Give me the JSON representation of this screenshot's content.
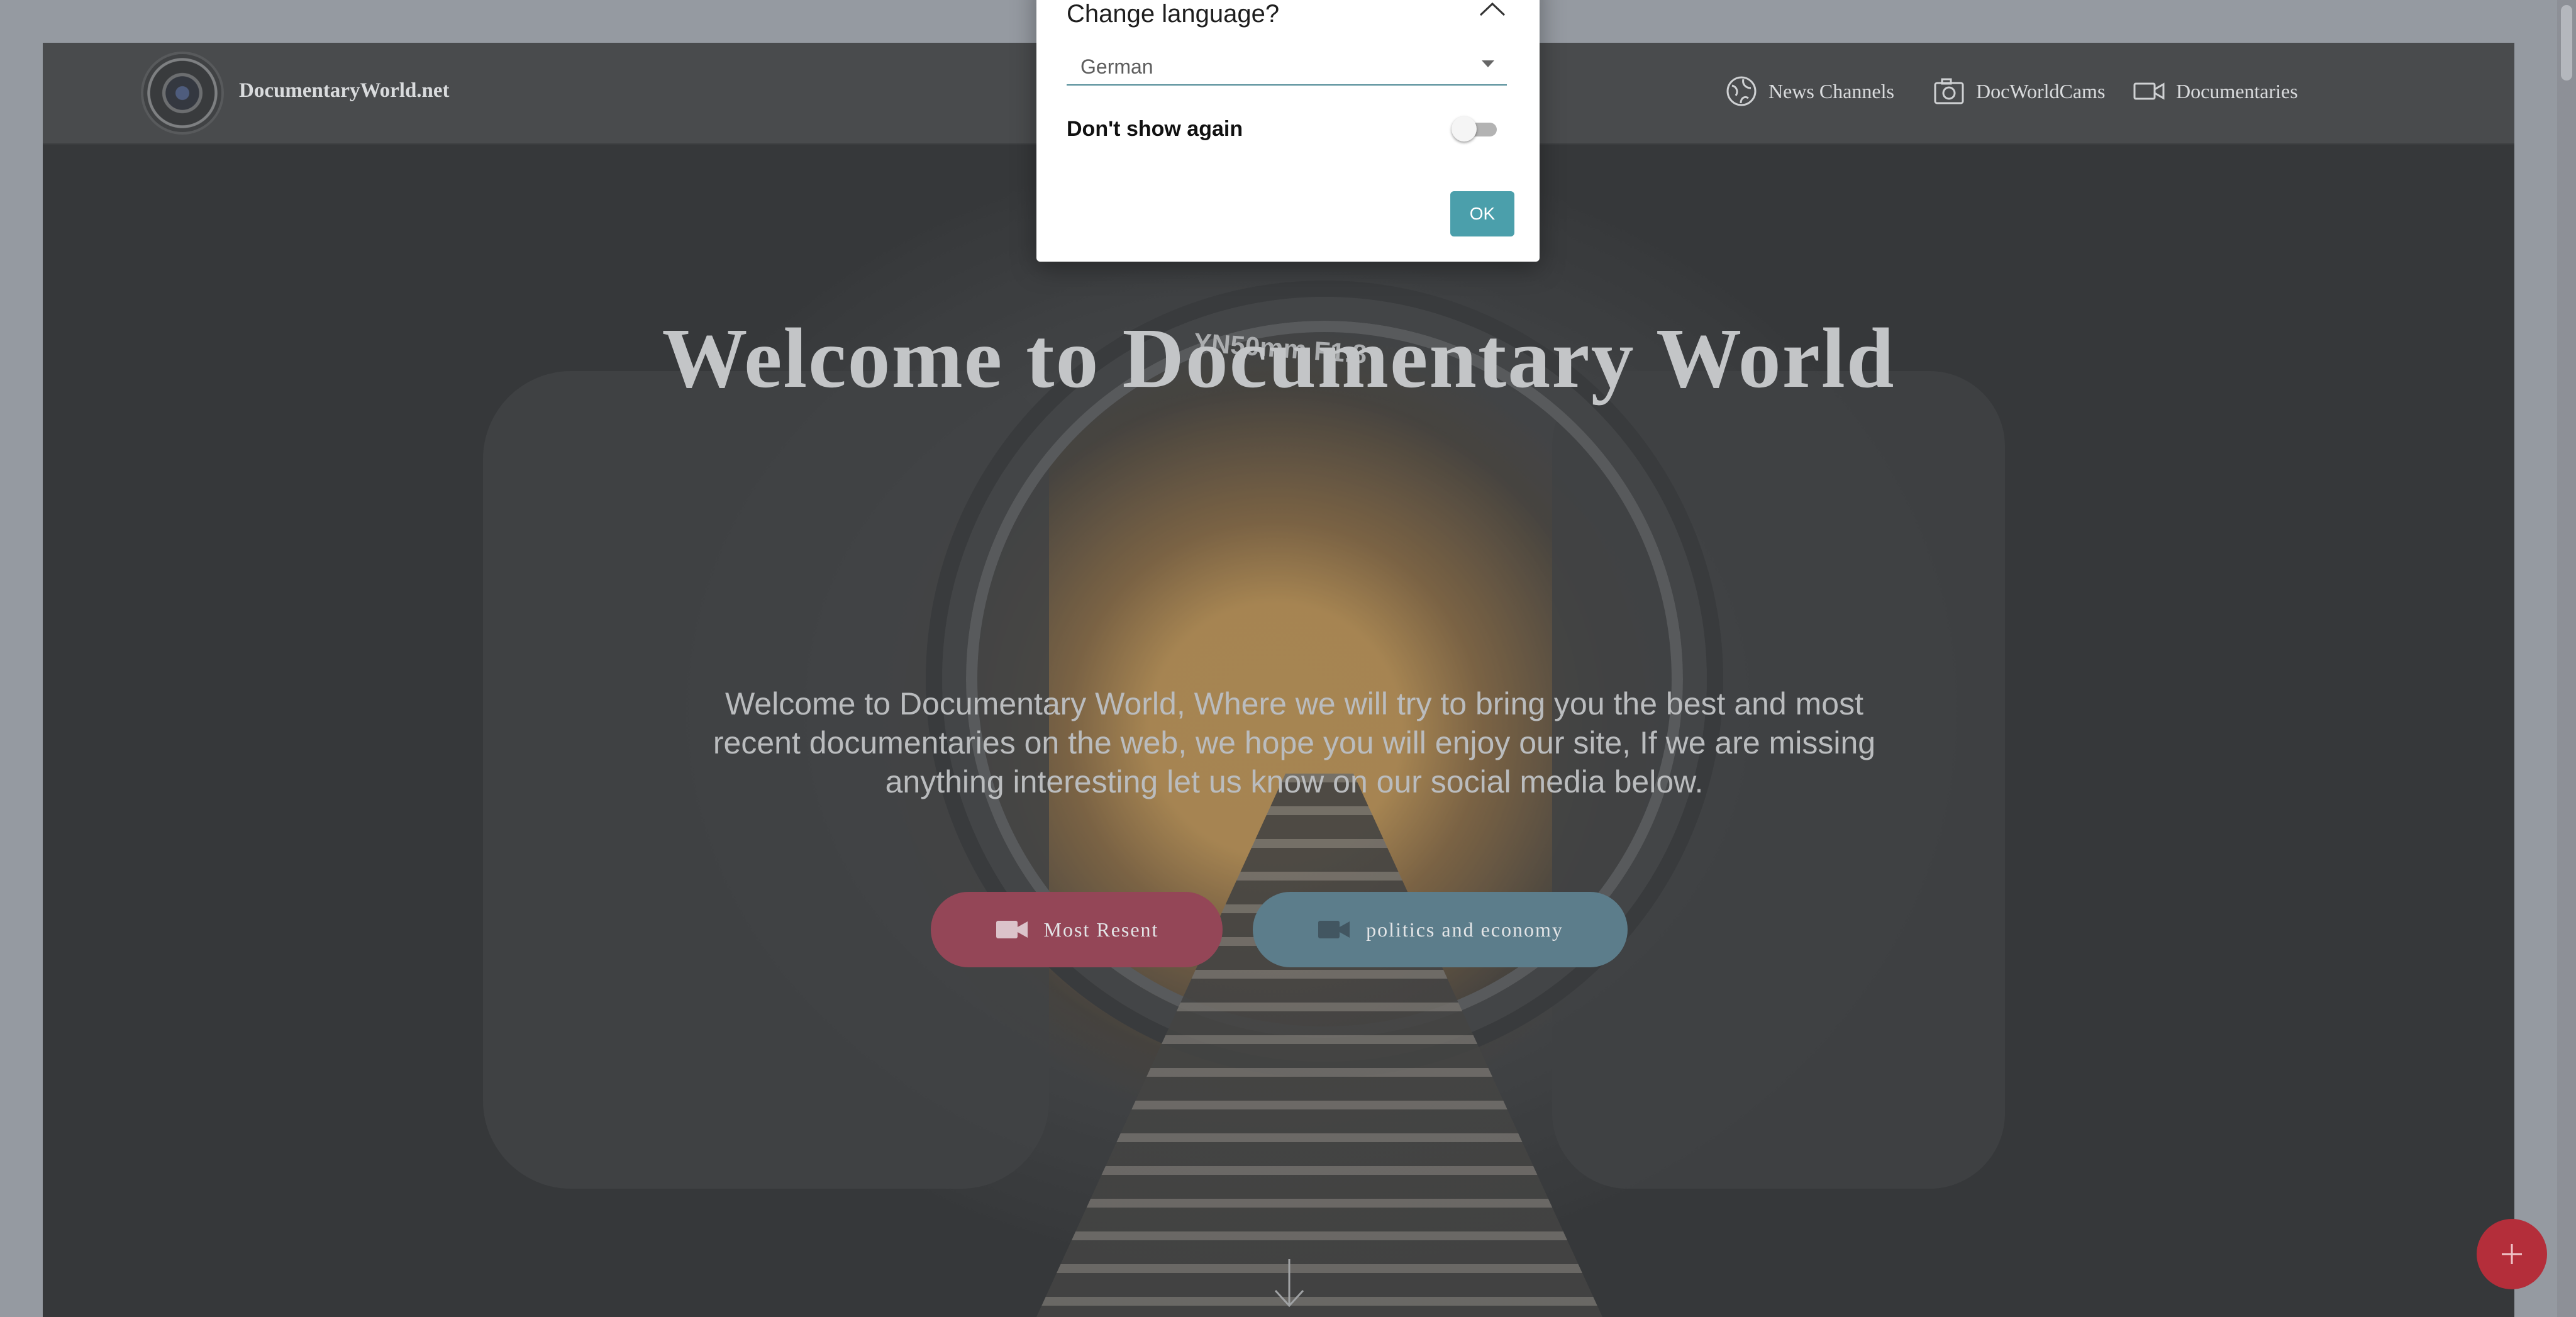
{
  "header": {
    "brand": "DocumentaryWorld.net",
    "nav": [
      {
        "label": "News Channels",
        "icon": "globe-icon"
      },
      {
        "label": "DocWorldCams",
        "icon": "camera-icon"
      },
      {
        "label": "Documentaries",
        "icon": "video-camera-icon"
      }
    ]
  },
  "hero": {
    "title": "Welcome to Documentary World",
    "description": "Welcome to Documentary World, Where we will try to bring you the best and most recent documentaries on the web, we hope you will enjoy our site, If we are missing anything interesting let us know on our social media below.",
    "lens_text": "YN50mm F1.8",
    "buttons": [
      {
        "label": "Most Resent",
        "icon": "video-camera-icon",
        "color": "#8a1f33"
      },
      {
        "label": "politics and economy",
        "icon": "video-camera-icon",
        "color": "#3f6878"
      }
    ]
  },
  "dialog": {
    "title": "Change language?",
    "selected_language": "German",
    "dont_show_label": "Don't show again",
    "dont_show_checked": false,
    "ok_label": "OK",
    "accent_color": "#4b9fab"
  },
  "fab": {
    "icon": "plus-icon",
    "color": "#b42e3a"
  }
}
